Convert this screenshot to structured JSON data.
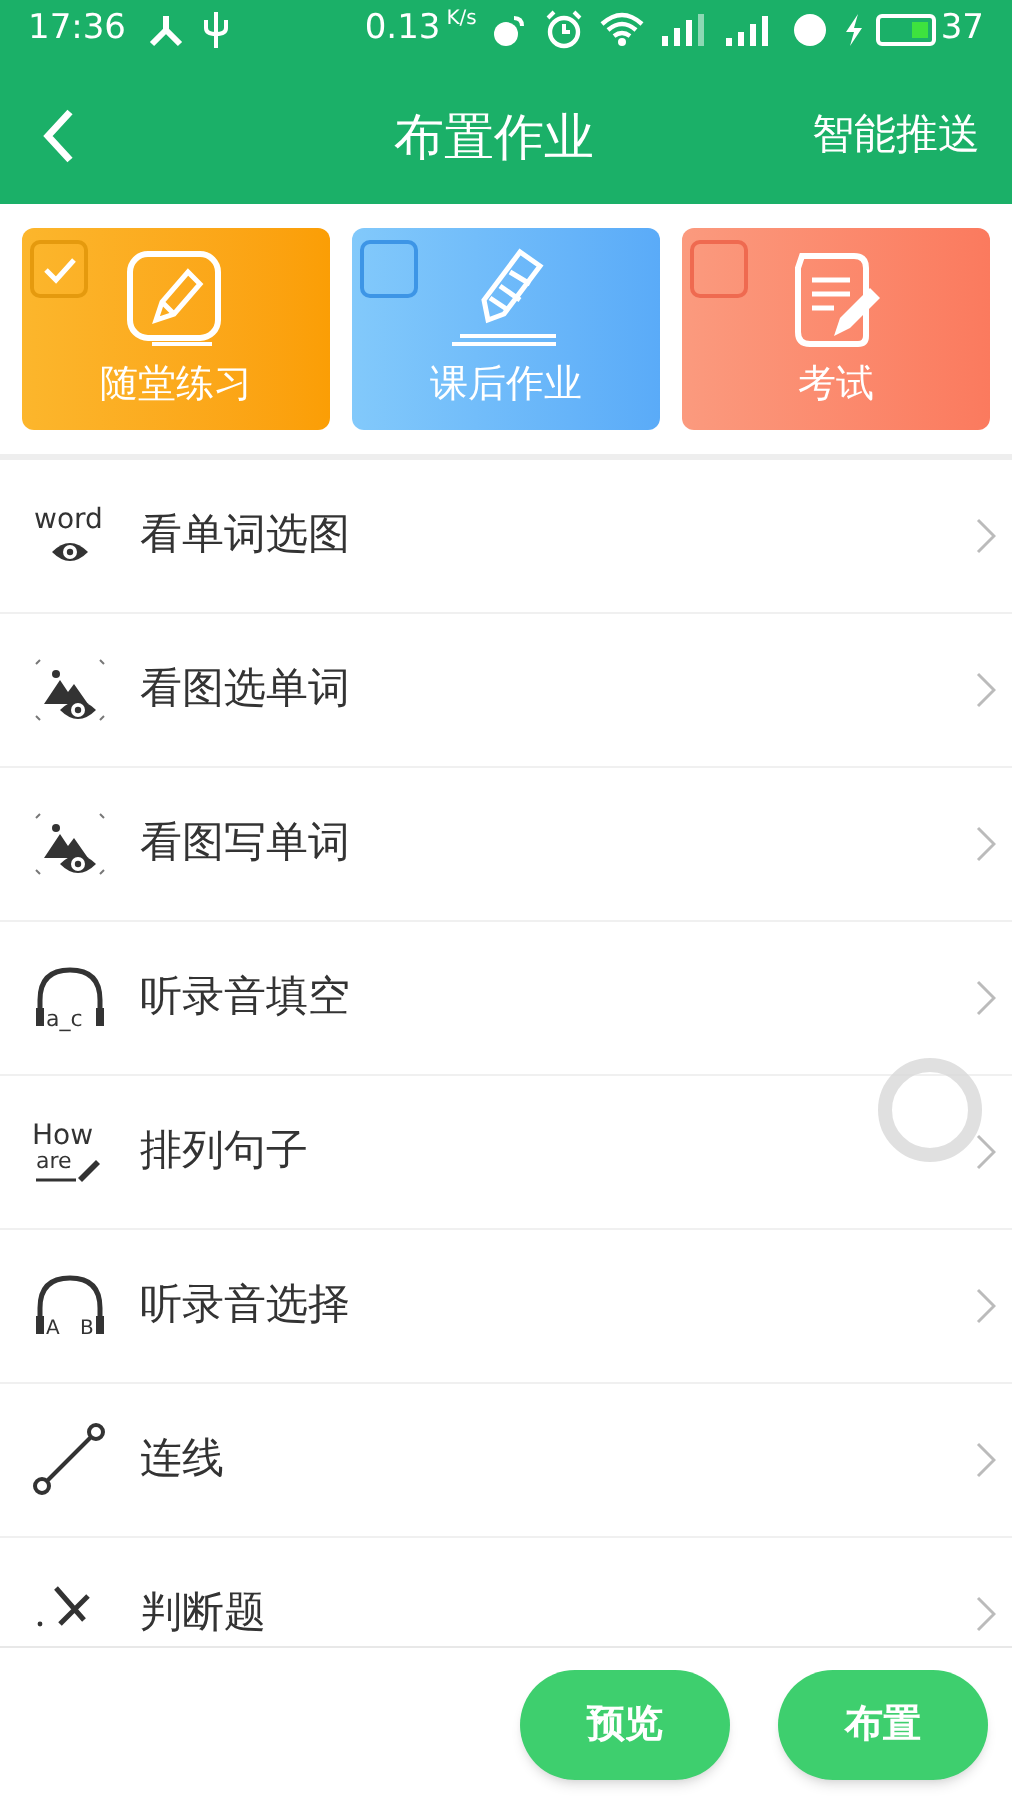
{
  "status_bar": {
    "time": "17:36",
    "speed": "0.13",
    "speed_unit": "K/s",
    "battery": "37"
  },
  "header": {
    "title": "布置作业",
    "action": "智能推送"
  },
  "categories": [
    {
      "label": "随堂练习",
      "selected": true,
      "kind": "practice"
    },
    {
      "label": "课后作业",
      "selected": false,
      "kind": "homework"
    },
    {
      "label": "考试",
      "selected": false,
      "kind": "exam"
    }
  ],
  "items": [
    {
      "label": "看单词选图",
      "kind": "word-eye",
      "icon_texts": [
        "word"
      ]
    },
    {
      "label": "看图选单词",
      "kind": "picture-eye"
    },
    {
      "label": "看图写单词",
      "kind": "picture-eye"
    },
    {
      "label": "听录音填空",
      "kind": "headphones",
      "icon_texts": [
        "a_c"
      ]
    },
    {
      "label": "排列句子",
      "kind": "sentence",
      "icon_texts": [
        "How",
        "are"
      ]
    },
    {
      "label": "听录音选择",
      "kind": "headphones-ab",
      "icon_texts": [
        "A",
        "B"
      ]
    },
    {
      "label": "连线",
      "kind": "connect"
    },
    {
      "label": "判断题",
      "kind": "judge"
    }
  ],
  "buttons": [
    {
      "label": "预览"
    },
    {
      "label": "布置"
    }
  ]
}
